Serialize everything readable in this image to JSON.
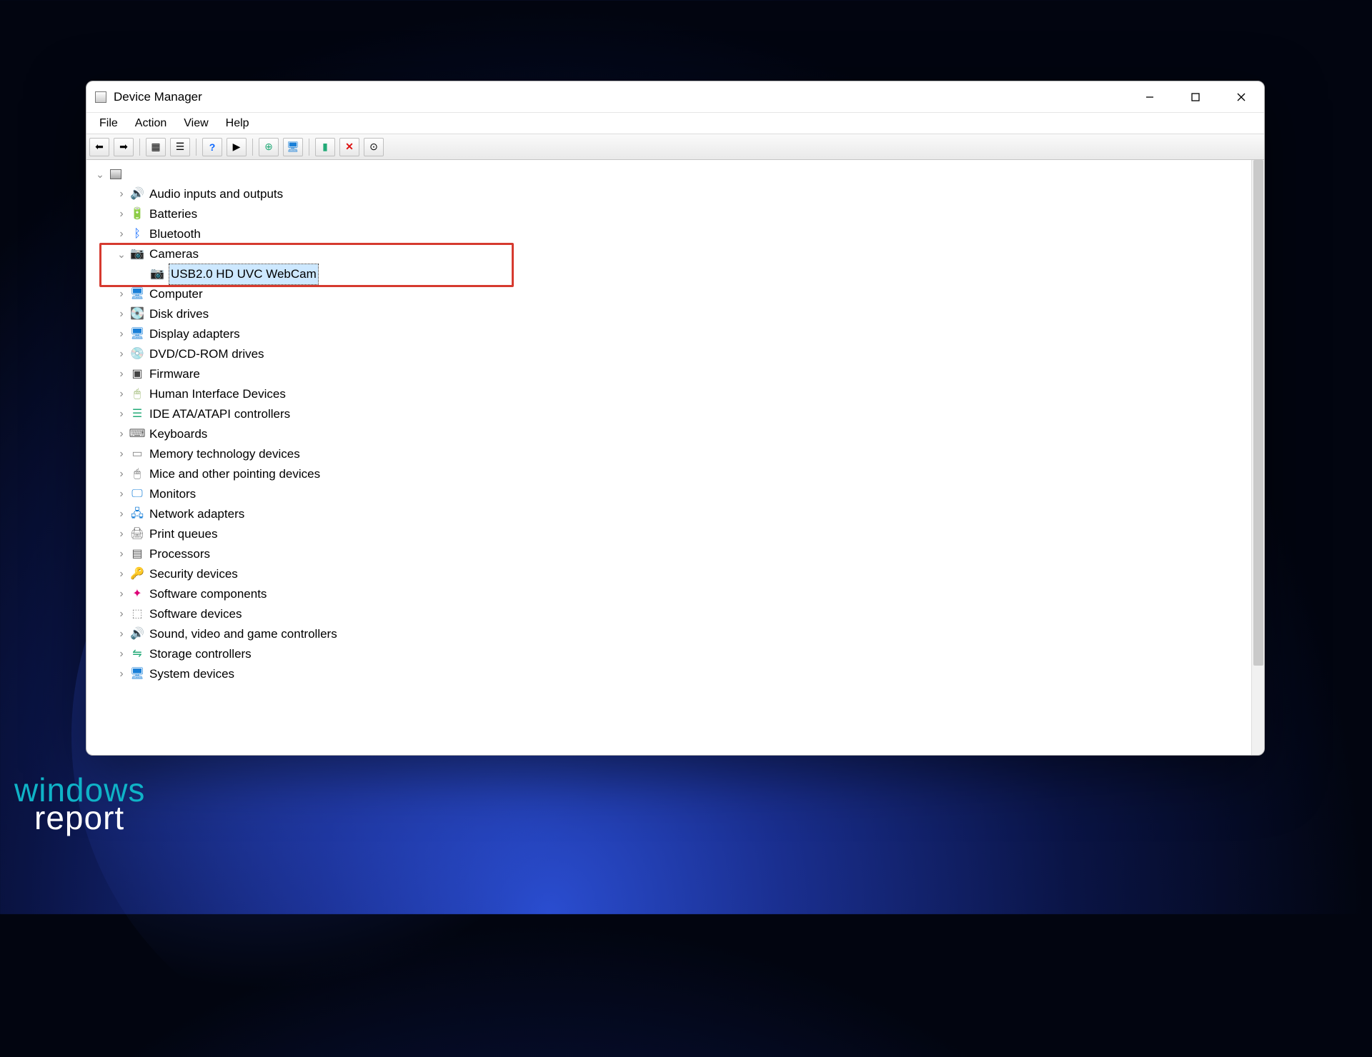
{
  "window": {
    "title": "Device Manager"
  },
  "menus": {
    "file": "File",
    "action": "Action",
    "view": "View",
    "help": "Help"
  },
  "toolbar": {
    "back": "back-icon",
    "forward": "forward-icon",
    "show_hidden": "show-hidden-icon",
    "properties": "properties-icon",
    "help": "help-icon",
    "scan": "scan-hardware-icon",
    "add_legacy": "add-legacy-icon",
    "update_driver": "update-driver-icon",
    "uninstall": "uninstall-icon",
    "disable": "disable-icon",
    "enable": "enable-icon"
  },
  "tree": {
    "root": "",
    "categories": [
      {
        "label": "Audio inputs and outputs",
        "icon": "audio"
      },
      {
        "label": "Batteries",
        "icon": "batt"
      },
      {
        "label": "Bluetooth",
        "icon": "bt"
      },
      {
        "label": "Cameras",
        "icon": "cam",
        "expanded": true,
        "children": [
          {
            "label": "USB2.0 HD UVC WebCam",
            "icon": "cam",
            "selected": true
          }
        ]
      },
      {
        "label": "Computer",
        "icon": "comp"
      },
      {
        "label": "Disk drives",
        "icon": "disk"
      },
      {
        "label": "Display adapters",
        "icon": "disp"
      },
      {
        "label": "DVD/CD-ROM drives",
        "icon": "dvd"
      },
      {
        "label": "Firmware",
        "icon": "fw"
      },
      {
        "label": "Human Interface Devices",
        "icon": "hid"
      },
      {
        "label": "IDE ATA/ATAPI controllers",
        "icon": "ide"
      },
      {
        "label": "Keyboards",
        "icon": "kb"
      },
      {
        "label": "Memory technology devices",
        "icon": "mem"
      },
      {
        "label": "Mice and other pointing devices",
        "icon": "mouse"
      },
      {
        "label": "Monitors",
        "icon": "mon"
      },
      {
        "label": "Network adapters",
        "icon": "net"
      },
      {
        "label": "Print queues",
        "icon": "print"
      },
      {
        "label": "Processors",
        "icon": "cpu"
      },
      {
        "label": "Security devices",
        "icon": "sec"
      },
      {
        "label": "Software components",
        "icon": "swc"
      },
      {
        "label": "Software devices",
        "icon": "swd"
      },
      {
        "label": "Sound, video and game controllers",
        "icon": "snd"
      },
      {
        "label": "Storage controllers",
        "icon": "stor"
      },
      {
        "label": "System devices",
        "icon": "sys"
      }
    ]
  },
  "icon_glyphs": {
    "audio": "🔊",
    "batt": "🔋",
    "bt": "ᛒ",
    "cam": "📷",
    "comp": "🖥",
    "disk": "💽",
    "disp": "🖥",
    "dvd": "💿",
    "fw": "▣",
    "hid": "🖱",
    "ide": "☰",
    "kb": "⌨",
    "mem": "▭",
    "mouse": "🖱",
    "mon": "🖵",
    "net": "🖧",
    "print": "🖨",
    "cpu": "▤",
    "sec": "🔑",
    "swc": "✦",
    "swd": "⬚",
    "snd": "🔊",
    "stor": "⇋",
    "sys": "🖥",
    "pc": "🖥"
  },
  "watermark": {
    "line1": "windows",
    "line2": "report"
  }
}
